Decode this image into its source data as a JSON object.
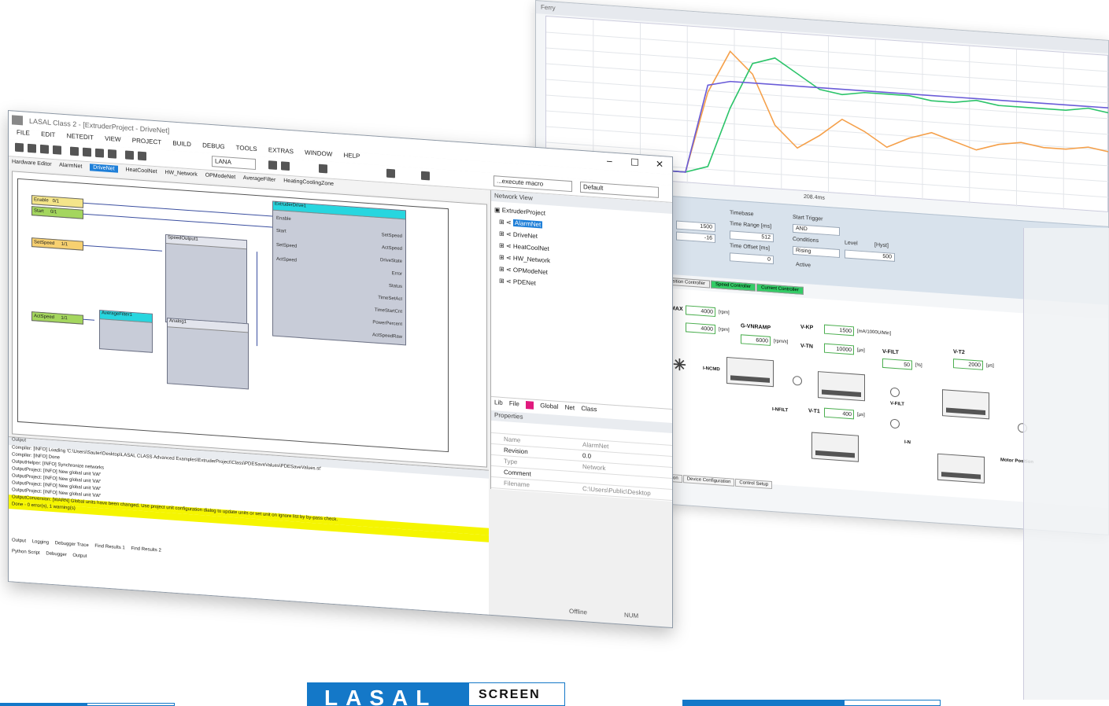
{
  "scope": {
    "title": "Ferry",
    "xaxis_label": "208.4ms",
    "trigger": {
      "timebase": "Timebase",
      "time_range": "Time Range [ms]",
      "time_range_val": "512",
      "time_offset": "Time Offset [ms]",
      "time_offset_val": "0",
      "active": "Active",
      "start_trigger": "Start Trigger",
      "cond": "Conditions",
      "level": "Level",
      "hyst": "[Hyst]",
      "rising": "Rising",
      "and": "AND",
      "level_val": "500",
      "l1": "1500",
      "l2": "-16"
    },
    "tabs": [
      "Position Controller",
      "Speed Controller",
      "Current Controller"
    ],
    "controller": {
      "nmax_label": "NMAX",
      "nmax_val": "4000",
      "nmax_unit": "[rpm]",
      "nmin_val": "4000",
      "nmin_unit": "[rpm]",
      "vnramp": "G-VNRAMP",
      "vnramp_val": "6000",
      "vnramp_unit": "[rpm/s]",
      "vkp": "V-KP",
      "vkp_val": "1500",
      "vkp_unit": "[mA/1000U/Min]",
      "vtn": "V-TN",
      "vtn_val": "10000",
      "vtn_unit": "[µs]",
      "vfilt": "V-FILT",
      "vfilt_val": "50",
      "vfilt_unit": "[%]",
      "vt2": "V-T2",
      "vt2_val": "2000",
      "vt2_unit": "[µs]",
      "vt1": "V-T1",
      "vt1_val": "400",
      "vt1_unit": "[µs]",
      "nref": "I-NCMD",
      "nist": "I-NFILT",
      "vfilt1": "V-FILT",
      "ist": "I-N",
      "motor": "Motor Position"
    },
    "btabs": [
      "Configuration",
      "Device Configuration",
      "Control Setup"
    ]
  },
  "main": {
    "title": "LASAL Class 2 - [ExtruderProject - DriveNet]",
    "menu": [
      "FILE",
      "EDIT",
      "NETEDIT",
      "VIEW",
      "PROJECT",
      "BUILD",
      "DEBUG",
      "TOOLS",
      "EXTRAS",
      "WINDOW",
      "HELP"
    ],
    "combo_macro": "...execute macro",
    "combo_default": "Default",
    "combo_zoom": "LANA",
    "doctabs": [
      "Hardware Editor",
      "AlarmNet",
      "DriveNet",
      "HeatCoolNet",
      "HW_Network",
      "OPModeNet",
      "AverageFilter",
      "HeatingCoolingZone"
    ],
    "blocks": {
      "extruder": "ExtruderDrive1",
      "speed": "SpeedOutput1",
      "avg": "AverageFilter1",
      "ana": "Analog1"
    },
    "sources": [
      "Enable    0/1",
      "Start     0/1",
      "SetSpeed     1/1",
      "ActSpeed     1/1"
    ],
    "ext_pins_left": [
      "Enable",
      "Start",
      "SetSpeed",
      "ActSpeed"
    ],
    "ext_pins_right": [
      "SetSpeed",
      "ActSpeed",
      "DriveState",
      "Error",
      "Status",
      "TimeSetAct",
      "TimeStartCnt",
      "PowerPercent",
      "ActSpeedRaw"
    ],
    "network_view": {
      "title": "Network View",
      "items": [
        "ExtruderProject",
        "AlarmNet",
        "DriveNet",
        "HeatCoolNet",
        "HW_Network",
        "OPModeNet",
        "PDENet"
      ]
    },
    "ntabs": [
      "Lib",
      "File",
      "Global",
      "Net",
      "Class"
    ],
    "properties": {
      "title": "Properties",
      "rows": [
        {
          "k": "Name",
          "v": "AlarmNet"
        },
        {
          "k": "Revision",
          "v": "0.0"
        },
        {
          "k": "Type",
          "v": "Network"
        },
        {
          "k": "Comment",
          "v": ""
        },
        {
          "k": "Filename",
          "v": "C:\\Users\\Public\\Desktop"
        }
      ]
    },
    "output": {
      "title": "Output",
      "lines": [
        "Compiler: [INFO] Loading 'C:\\Users\\Sauter\\Desktop\\LASAL CLASS Advanced Examples\\ExtruderProject\\Class\\PDESaveValues\\PDESaveValues.st'",
        "Compiler: [INFO] Done",
        "OutputHelper: [INFO] Synchronize networks",
        "OutputProject: [INFO] New global unit 'kW'",
        "OutputProject: [INFO] New global unit 'kW'",
        "OutputProject: [INFO] New global unit 'kW'",
        "OutputProject: [INFO] New global unit 'kW'",
        "OutputConversion: [WARN] Global units have been changed. Use project unit configuration dialog to update units or set unit on ignore list by by-pass check.",
        "Done - 0 error(s), 1 warning(s)"
      ],
      "tabs": [
        "Output",
        "Logging",
        "Debugger Trace",
        "Find Results 1",
        "Find Results 2"
      ],
      "bottom": [
        "Python Script",
        "Debugger",
        "Output"
      ]
    },
    "status": {
      "offline": "Offline",
      "num": "NUM"
    }
  },
  "logos": {
    "lasal": "LASAL",
    "screen": "SCREEN"
  },
  "chart_data": {
    "type": "line",
    "series": [
      {
        "color": "#f5a04a",
        "values": [
          0.1,
          0.1,
          0.1,
          2.4,
          3.6,
          3.0,
          1.6,
          1.0,
          1.4,
          1.9,
          1.6,
          1.2,
          1.5,
          1.7,
          1.5,
          1.3,
          1.5,
          1.6,
          1.5,
          1.5,
          1.6,
          1.5
        ]
      },
      {
        "color": "#2cc46a",
        "values": [
          0.1,
          0.1,
          0.1,
          0.3,
          2.0,
          3.3,
          3.5,
          3.1,
          2.7,
          2.6,
          2.7,
          2.7,
          2.7,
          2.6,
          2.6,
          2.7,
          2.6,
          2.6,
          2.6,
          2.6,
          2.7,
          2.6
        ]
      },
      {
        "color": "#6a5cd8",
        "values": [
          0.1,
          0.1,
          0.1,
          2.6,
          2.75,
          2.75,
          2.75,
          2.75,
          2.75,
          2.75,
          2.75,
          2.75,
          2.75,
          2.75,
          2.75,
          2.75,
          2.75,
          2.75,
          2.75,
          2.75,
          2.75,
          2.75
        ]
      }
    ]
  }
}
